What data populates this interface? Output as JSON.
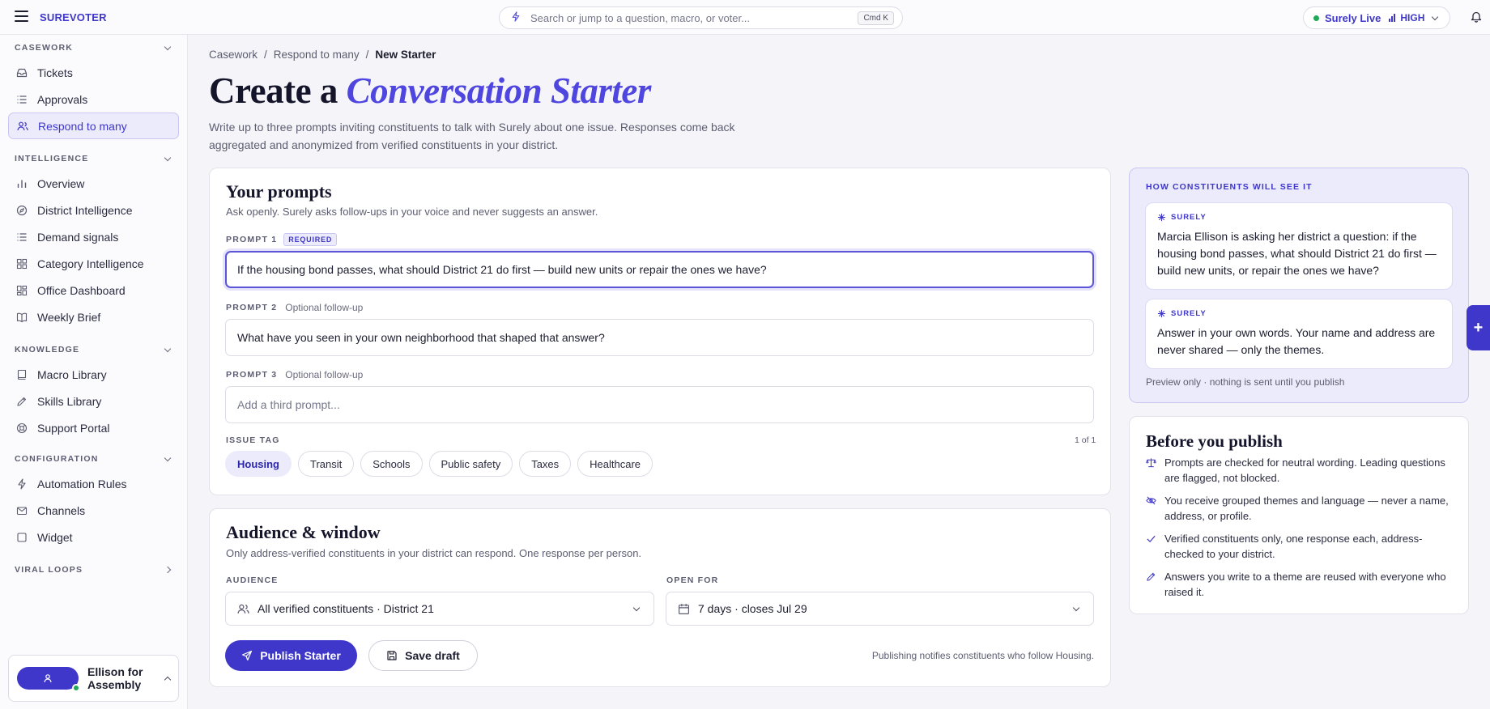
{
  "topbar": {
    "brand": "SUREVOTER",
    "search_placeholder": "Search or jump to a question, macro, or voter...",
    "search_shortcut": "Cmd K",
    "live_label": "Surely Live",
    "live_level": "HIGH"
  },
  "sidebar": {
    "sections": [
      {
        "label": "CASEWORK",
        "items": [
          "Tickets",
          "Approvals",
          "Respond to many"
        ]
      },
      {
        "label": "INTELLIGENCE",
        "items": [
          "Overview",
          "District Intelligence",
          "Demand signals",
          "Category Intelligence",
          "Office Dashboard",
          "Weekly Brief"
        ]
      },
      {
        "label": "KNOWLEDGE",
        "items": [
          "Macro Library",
          "Skills Library",
          "Support Portal"
        ]
      },
      {
        "label": "CONFIGURATION",
        "items": [
          "Automation Rules",
          "Channels",
          "Widget"
        ]
      },
      {
        "label": "VIRAL LOOPS",
        "items": []
      }
    ],
    "active_item": "Respond to many",
    "account_name": "Ellison for Assembly"
  },
  "breadcrumb": [
    "Casework",
    "Respond to many",
    "New Starter"
  ],
  "page": {
    "title_prefix": "Create a",
    "title_accent": "Conversation Starter",
    "subtitle": "Write up to three prompts inviting constituents to talk with Surely about one issue. Responses come back aggregated and anonymized from verified constituents in your district."
  },
  "prompts_card": {
    "title": "Your prompts",
    "subtitle": "Ask openly. Surely asks follow-ups in your voice and never suggests an answer.",
    "prompt1": {
      "label": "PROMPT 1",
      "badge": "REQUIRED",
      "value": "If the housing bond passes, what should District 21 do first — build new units or repair the ones we have?"
    },
    "prompt2": {
      "label": "PROMPT 2",
      "hint": "Optional follow-up",
      "value": "What have you seen in your own neighborhood that shaped that answer?"
    },
    "prompt3": {
      "label": "PROMPT 3",
      "hint": "Optional follow-up",
      "placeholder": "Add a third prompt..."
    },
    "issue_tag_label": "ISSUE TAG",
    "issue_tag_counter": "1 of 1",
    "tags": [
      "Housing",
      "Transit",
      "Schools",
      "Public safety",
      "Taxes",
      "Healthcare"
    ],
    "selected_tag": "Housing"
  },
  "audience_card": {
    "title": "Audience & window",
    "subtitle": "Only address-verified constituents in your district can respond. One response per person.",
    "audience_label": "AUDIENCE",
    "audience_value": "All verified constituents · District 21",
    "window_label": "OPEN FOR",
    "window_value": "7 days · closes Jul 29",
    "publish_label": "Publish Starter",
    "save_label": "Save draft",
    "publish_note": "Publishing notifies constituents who follow Housing."
  },
  "preview": {
    "heading": "HOW CONSTITUENTS WILL SEE IT",
    "speaker": "SURELY",
    "message1": "Marcia Ellison is asking her district a question: if the housing bond passes, what should District 21 do first — build new units, or repair the ones we have?",
    "message2": "Answer in your own words. Your name and address are never shared — only the themes.",
    "footer": "Preview only · nothing is sent until you publish"
  },
  "before_publish": {
    "title": "Before you publish",
    "items": [
      {
        "icon": "scale-icon",
        "text": "Prompts are checked for neutral wording. Leading questions are flagged, not blocked."
      },
      {
        "icon": "eye-off-icon",
        "text": "You receive grouped themes and language — never a name, address, or profile."
      },
      {
        "icon": "check-icon",
        "text": "Verified constituents only, one response each, address-checked to your district."
      },
      {
        "icon": "pencil-icon",
        "text": "Answers you write to a theme are reused with everyone who raised it."
      }
    ]
  },
  "colors": {
    "accent": "#3e37c9",
    "accent_soft": "#ecebfb",
    "live": "#1fa855"
  }
}
